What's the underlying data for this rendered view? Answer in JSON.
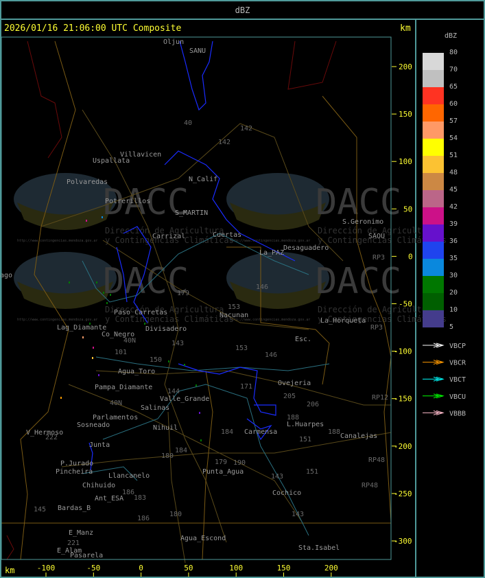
{
  "header": {
    "title": "dBZ"
  },
  "map": {
    "title": "2026/01/16 21:06:00 UTC Composite",
    "unit": "km",
    "y_ticks": [
      "200",
      "150",
      "100",
      "50",
      "0",
      "-50",
      "-100",
      "-150",
      "-200",
      "-250",
      "-300"
    ],
    "x_ticks": [
      "-100",
      "-50",
      "0",
      "50",
      "100",
      "150",
      "200"
    ],
    "places": [
      "Oljun",
      "SANU",
      "Uspallata",
      "Villavicen",
      "Polvaredas",
      "Potrerillos",
      "N_Calif",
      "S_MARTIN",
      "Carrizal",
      "Cuertas",
      "La_PAZ",
      "Desaguadero",
      "S.Geronimo",
      "SAOU",
      "ago",
      "Lag_Diamante",
      "Co_Negro",
      "Paso_Carretas",
      "Divisadero",
      "Nacunan",
      "La_Horqueta",
      "Esc.",
      "Agua_Toro",
      "Pampa_Diamante",
      "Valle_Grande",
      "Salinas",
      "Parlamentos",
      "Sosneado",
      "Nihuil",
      "V_Hermoso",
      "Junta",
      "P.Jurado",
      "Pincheira",
      "Llancanelo",
      "Chihuido",
      "Ant_ESA",
      "Bardas_B",
      "E_Manz",
      "E_Alam",
      "Pasarela",
      "Agua_Escond",
      "Punta_Agua",
      "Ovejeria",
      "L.Huarpes",
      "Canalejas",
      "Carmensa",
      "Cochico",
      "Sta.Isabel"
    ],
    "routes": [
      "40",
      "142",
      "142",
      "153",
      "153",
      "143",
      "146",
      "146",
      "205",
      "206",
      "188",
      "188",
      "151",
      "151",
      "184",
      "184",
      "179",
      "179",
      "190",
      "180",
      "180",
      "186",
      "186",
      "183",
      "101",
      "150",
      "144",
      "171",
      "143",
      "143",
      "RP3",
      "RP3",
      "RP12",
      "RP48",
      "RP48",
      "145",
      "221",
      "222",
      "40N",
      "40N"
    ],
    "watermark": {
      "logo": "DACC",
      "line1": "Dirección de Agricultura",
      "line2": "y Contingencias Climáticas",
      "url": "http://www.contingencias.mendoza.gov.ar"
    }
  },
  "legend": {
    "title": "dBZ",
    "levels": [
      {
        "label": "80",
        "color": "#d8d8d8"
      },
      {
        "label": "70",
        "color": "#c0c0c0"
      },
      {
        "label": "65",
        "color": "#ff3322"
      },
      {
        "label": "60",
        "color": "#ff6600"
      },
      {
        "label": "57",
        "color": "#ff9966"
      },
      {
        "label": "54",
        "color": "#ffff00"
      },
      {
        "label": "51",
        "color": "#fcc232"
      },
      {
        "label": "48",
        "color": "#cc8844"
      },
      {
        "label": "45",
        "color": "#bb6688"
      },
      {
        "label": "42",
        "color": "#cc1188"
      },
      {
        "label": "39",
        "color": "#6611cc"
      },
      {
        "label": "36",
        "color": "#1f44ee"
      },
      {
        "label": "35",
        "color": "#0a88dd"
      },
      {
        "label": "30",
        "color": "#007700"
      },
      {
        "label": "20",
        "color": "#005f00"
      },
      {
        "label": "10",
        "color": "#443c8c"
      }
    ],
    "last_label": "5",
    "radars": [
      {
        "label": "VBCP",
        "color": "#ffffff"
      },
      {
        "label": "VBCR",
        "color": "#ff9900"
      },
      {
        "label": "VBCT",
        "color": "#00ffff"
      },
      {
        "label": "VBCU",
        "color": "#00ff00"
      },
      {
        "label": "VBBB",
        "color": "#ffbbcc"
      }
    ]
  }
}
